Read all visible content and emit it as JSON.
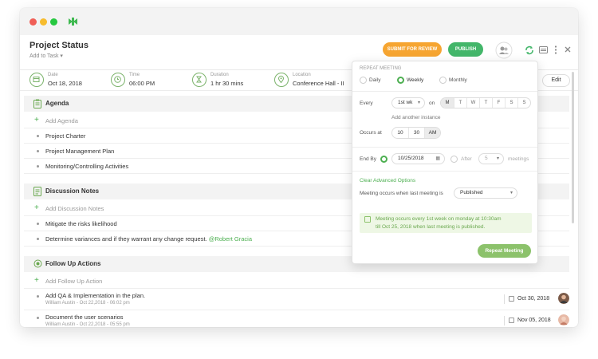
{
  "header": {
    "title": "Project Status",
    "add_to_task": "Add to Task",
    "submit_label": "SUBMIT FOR REVIEW",
    "publish_label": "PUBLISH"
  },
  "meta": {
    "date_label": "Date",
    "date_value": "Oct 18, 2018",
    "time_label": "Time",
    "time_value": "06:00 PM",
    "duration_label": "Duration",
    "duration_value": "1 hr 30 mins",
    "location_label": "Location",
    "location_value": "Conference Hall - II",
    "edit_label": "Edit"
  },
  "agenda": {
    "title": "Agenda",
    "add_label": "Add Agenda",
    "items": [
      "Project Charter",
      "Project Management Plan",
      "Monitoring/Controlling Activities"
    ]
  },
  "discussion": {
    "title": "Discussion Notes",
    "add_label": "Add Discussion Notes",
    "item1": "Mitigate the risks likelihood",
    "item2_text": "Determine variances and if they warrant any change request.",
    "item2_mention": "@Robert Gracia"
  },
  "followup": {
    "title": "Follow Up Actions",
    "add_label": "Add Follow Up Action",
    "items": [
      {
        "text": "Add QA & Implementation in the plan.",
        "sub": "William Austin - Oct 22,2018 - 06:02 pm",
        "date": "Oct 30, 2018"
      },
      {
        "text": "Document the user scenarios",
        "sub": "William Austin - Oct 22,2018 - 05:55 pm",
        "date": "Nov 05, 2018"
      }
    ]
  },
  "repeat": {
    "caption": "REPEAT MEETING",
    "daily": "Daily",
    "weekly": "Weekly",
    "monthly": "Monthly",
    "every_label": "Every",
    "every_value": "1st wk",
    "on_label": "on",
    "days": [
      "M",
      "T",
      "W",
      "T",
      "F",
      "S",
      "S"
    ],
    "add_instance": "Add another instance",
    "occurs_label": "Occurs at",
    "hour": "10",
    "minute": "30",
    "ampm": "AM",
    "endby_label": "End By",
    "end_date": "10/25/2018",
    "after_label": "After",
    "after_count": "5",
    "meetings_label": "meetings",
    "clear_advanced": "Clear Advanced Options",
    "occurs_when_label": "Meeting occurs when last meeting is",
    "occurs_when_value": "Published",
    "info_line1": "Meeting occurs every 1st week on monday at 10:30am",
    "info_line2": "till Oct 25, 2018 when last meeting is published.",
    "repeat_button": "Repeat Meeting"
  },
  "colors": {
    "accent_green": "#43b66a",
    "submit_orange": "#f6a531",
    "light_green": "#8cc26b"
  }
}
